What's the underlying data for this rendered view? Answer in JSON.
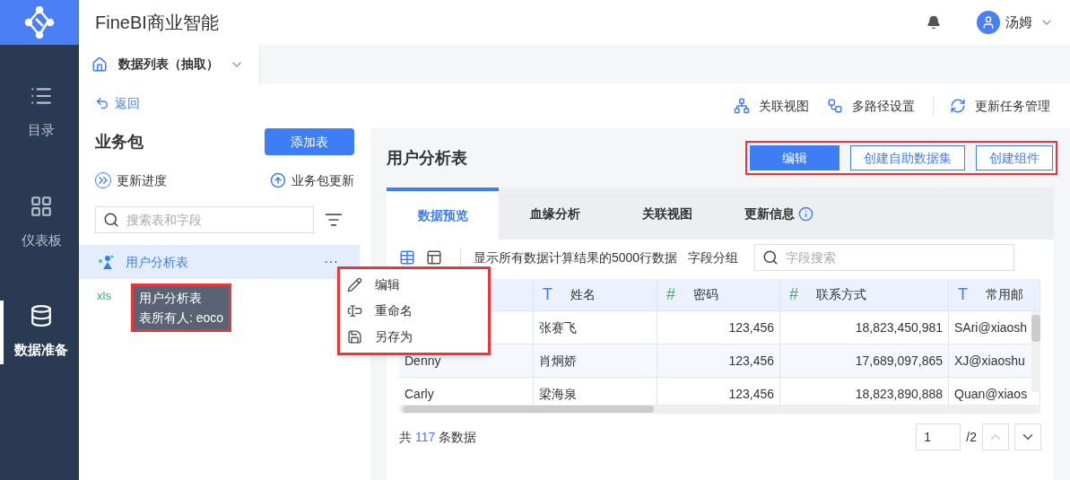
{
  "app_title": "FineBI商业智能",
  "user": {
    "name": "汤姆"
  },
  "nav": [
    {
      "label": "目录",
      "kind": "list",
      "selected": false
    },
    {
      "label": "仪表板",
      "kind": "dashboard",
      "selected": false
    },
    {
      "label": "数据准备",
      "kind": "database",
      "selected": true
    }
  ],
  "tab": {
    "label": "数据列表（抽取）"
  },
  "back": "返回",
  "package": {
    "title": "业务包",
    "add_button": "添加表",
    "update_progress": "更新进度",
    "package_update": "业务包更新",
    "search_placeholder": "搜索表和字段"
  },
  "tables": [
    {
      "name": "用户分析表",
      "kind": "analysis",
      "selected": true,
      "more": "···"
    },
    {
      "kind": "xls",
      "selected": false,
      "icon": "xls"
    }
  ],
  "tooltip": {
    "title": "用户分析表",
    "owner": "表所有人: eoco"
  },
  "context_menu": [
    {
      "label": "编辑",
      "kind": "edit"
    },
    {
      "label": "重命名",
      "kind": "rename"
    },
    {
      "label": "另存为",
      "kind": "save"
    }
  ],
  "top_actions": [
    {
      "label": "关联视图",
      "kind": "relation"
    },
    {
      "label": "多路径设置",
      "kind": "paths"
    },
    {
      "label": "更新任务管理",
      "kind": "tasks"
    }
  ],
  "detail": {
    "title": "用户分析表",
    "buttons": [
      {
        "label": "编辑",
        "selected": true
      },
      {
        "label": "创建自助数据集",
        "selected": false
      },
      {
        "label": "创建组件",
        "selected": false
      }
    ],
    "tabs": [
      {
        "label": "数据预览",
        "selected": true,
        "info": false
      },
      {
        "label": "血缘分析",
        "selected": false,
        "info": false
      },
      {
        "label": "关联视图",
        "selected": false,
        "info": false
      },
      {
        "label": "更新信息",
        "selected": false,
        "info": true
      }
    ],
    "toolbar_text": "显示所有数据计算结果的5000行数据",
    "group_label": "字段分组",
    "field_search_placeholder": "字段搜索",
    "columns": [
      {
        "kind": "text"
      },
      {
        "name": "姓名",
        "kind": "text",
        "icon": "T"
      },
      {
        "name": "密码",
        "kind": "number",
        "icon": "#"
      },
      {
        "name": "联系方式",
        "kind": "number",
        "icon": "#"
      },
      {
        "name": "常用邮",
        "kind": "text",
        "icon": "T"
      }
    ],
    "rows": [
      [
        null,
        "张赛飞",
        "123,456",
        "18,823,450,981",
        "SAri@xiaosh"
      ],
      [
        "Denny",
        "肖炯娇",
        "123,456",
        "17,689,097,865",
        "XJ@xiaoshu"
      ],
      [
        "Carly",
        "梁海泉",
        "123,456",
        "18,823,890,888",
        "Quan@xiaos"
      ]
    ],
    "footer": {
      "prefix": "共",
      "count": "117",
      "suffix": "条数据"
    },
    "pagination": {
      "page": "1",
      "total": "/2"
    }
  }
}
